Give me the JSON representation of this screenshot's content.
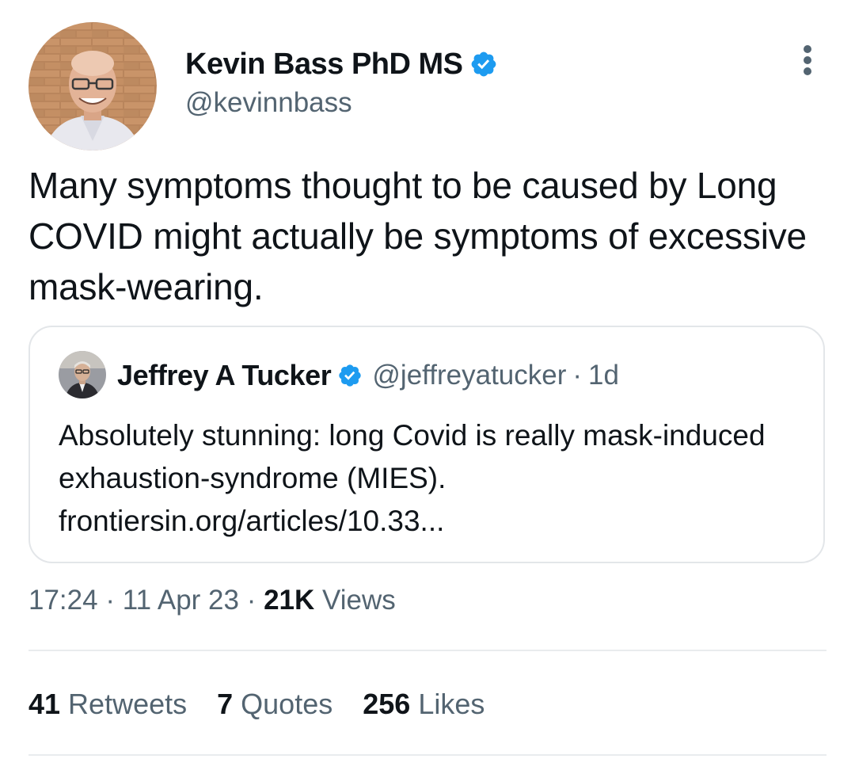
{
  "tweet": {
    "author": {
      "name": "Kevin Bass PhD MS",
      "handle": "@kevinnbass",
      "verified": true
    },
    "text": "Many symptoms thought to be caused by Long COVID might actually be symptoms of excessive mask-wearing.",
    "more_icon": "more-vertical-icon",
    "quoted_tweet": {
      "author_name": "Jeffrey A Tucker",
      "verified": true,
      "handle": "@jeffreyatucker",
      "separator": "·",
      "time": "1d",
      "text": "Absolutely stunning: long Covid is really mask-induced exhaustion-syndrome (MIES). frontiersin.org/articles/10.33..."
    },
    "meta": {
      "time": "17:24",
      "separator": "·",
      "date": "11 Apr 23",
      "views_count": "21K",
      "views_label": "Views"
    },
    "stats": [
      {
        "count": "41",
        "label": "Retweets"
      },
      {
        "count": "7",
        "label": "Quotes"
      },
      {
        "count": "256",
        "label": "Likes"
      }
    ],
    "colors": {
      "verified": "#1d9bf0",
      "text": "#0f1419",
      "secondary": "#536471",
      "border": "#e3e6e9"
    }
  }
}
